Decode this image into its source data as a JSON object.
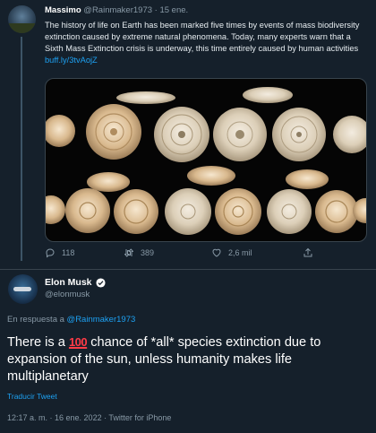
{
  "tweet_1": {
    "author_name": "Massimo",
    "author_handle": "@Rainmaker1973",
    "separator": "·",
    "date": "15 ene.",
    "text": "The history of life on Earth has been marked five times by events of mass biodiversity extinction caused by extreme natural phenomena. Today, many experts warn that a Sixth Mass Extinction crisis is underway, this time entirely caused by human activities",
    "link": "buff.ly/3tvAojZ",
    "media_description_icon": "shell-collection-image",
    "counts": {
      "replies": "118",
      "retweets": "389",
      "likes": "2,6 mil"
    }
  },
  "tweet_2": {
    "author_name": "Elon Musk",
    "author_handle": "@elonmusk",
    "reply_prefix": "En respuesta a",
    "reply_handle": "@Rainmaker1973",
    "text_before": "There is a",
    "emoji": "100",
    "text_after": "chance of *all* species extinction due to expansion of the sun, unless humanity makes life multiplanetary",
    "translate_label": "Traducir Tweet",
    "timestamp": "12:17 a. m. · 16 ene. 2022 · Twitter for iPhone"
  },
  "colors": {
    "background": "#15202b",
    "link": "#1da1f2",
    "secondary_text": "#8899a6",
    "divider": "#38444d",
    "emoji_red": "#ff3b47"
  }
}
